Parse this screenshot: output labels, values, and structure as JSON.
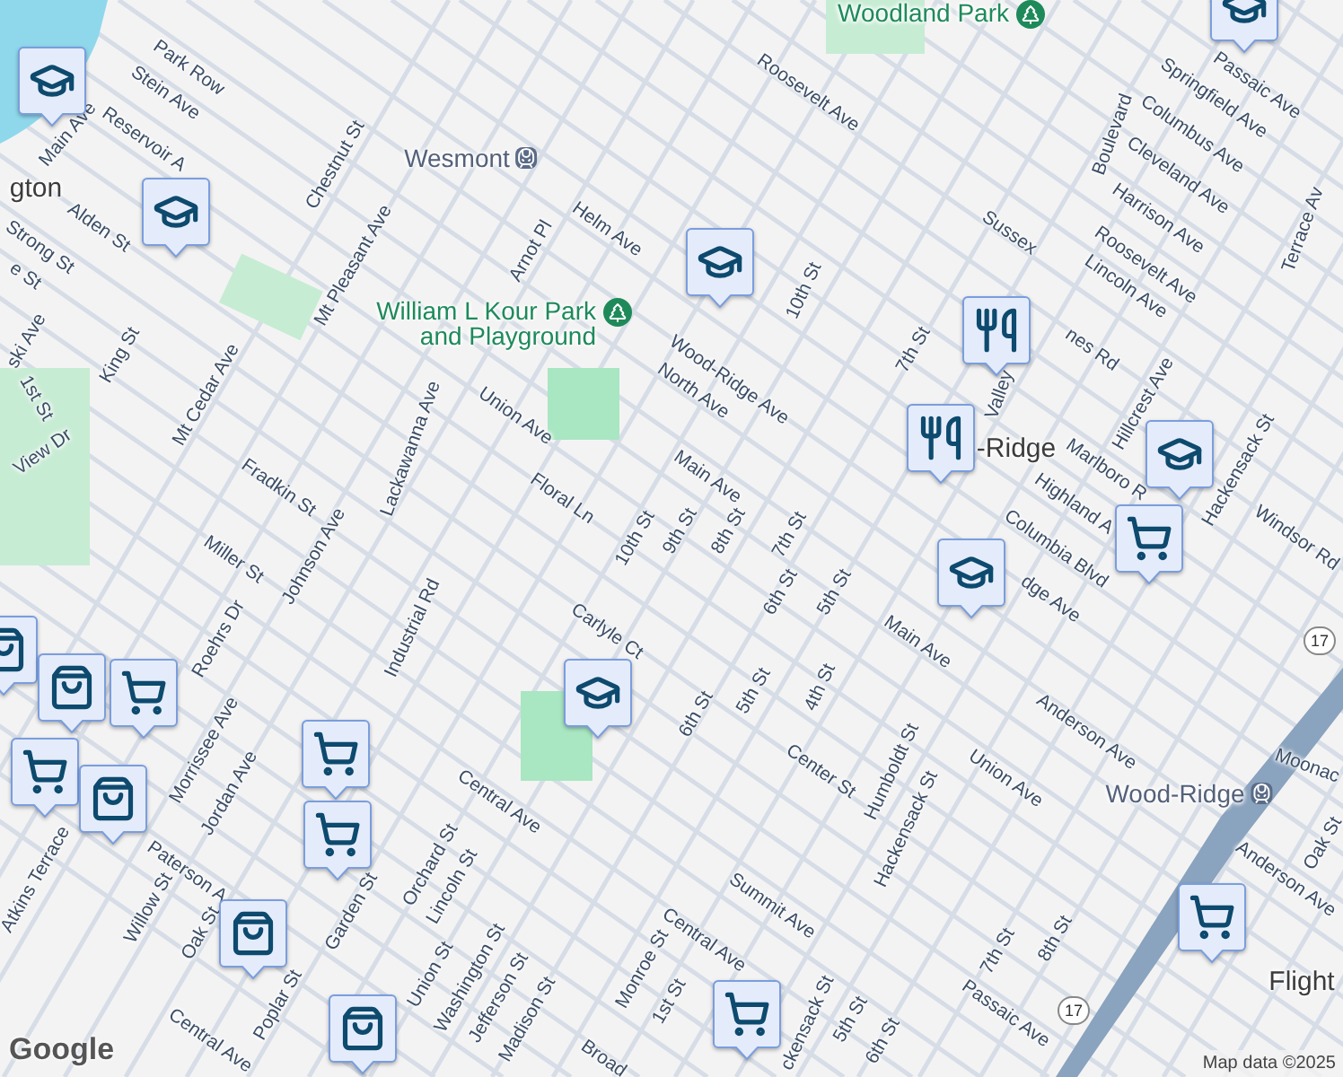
{
  "labels": [
    {
      "text": "Park Row",
      "kind": "street"
    },
    {
      "text": "Stein Ave",
      "kind": "street"
    },
    {
      "text": "Main Ave",
      "kind": "street"
    },
    {
      "text": "Reservoir A",
      "kind": "street"
    },
    {
      "text": "gton",
      "kind": "place"
    },
    {
      "text": "Alden St",
      "kind": "street"
    },
    {
      "text": "Strong St",
      "kind": "street"
    },
    {
      "text": "e St",
      "kind": "street"
    },
    {
      "text": "Chestnut St",
      "kind": "street"
    },
    {
      "text": "Wesmont",
      "kind": "station"
    },
    {
      "text": "Mt Pleasant Ave",
      "kind": "street"
    },
    {
      "text": "Helm Ave",
      "kind": "street"
    },
    {
      "text": "Arnot Pl",
      "kind": "street"
    },
    {
      "text": "William L Kour Park and Playground",
      "kind": "park"
    },
    {
      "text": "ski Ave",
      "kind": "street"
    },
    {
      "text": "King St",
      "kind": "street"
    },
    {
      "text": "1st St",
      "kind": "street"
    },
    {
      "text": "Mt Cedar Ave",
      "kind": "street"
    },
    {
      "text": "Union Ave",
      "kind": "street"
    },
    {
      "text": "Lackawanna Ave",
      "kind": "street"
    },
    {
      "text": "Fradkin St",
      "kind": "street"
    },
    {
      "text": "View Dr",
      "kind": "street"
    },
    {
      "text": "Floral Ln",
      "kind": "street"
    },
    {
      "text": "Woodland Park",
      "kind": "park"
    },
    {
      "text": "Roosevelt Ave",
      "kind": "street"
    },
    {
      "text": "Passaic Ave",
      "kind": "street"
    },
    {
      "text": "Boulevard",
      "kind": "street"
    },
    {
      "text": "Springfield Ave",
      "kind": "street"
    },
    {
      "text": "Columbus Ave",
      "kind": "street"
    },
    {
      "text": "Cleveland Ave",
      "kind": "street"
    },
    {
      "text": "Harrison Ave",
      "kind": "street"
    },
    {
      "text": "Roosevelt Ave",
      "kind": "street"
    },
    {
      "text": "Lincoln Ave",
      "kind": "street"
    },
    {
      "text": "Terrace Av",
      "kind": "street"
    },
    {
      "text": "Sussex",
      "kind": "street"
    },
    {
      "text": "nes Rd",
      "kind": "street"
    },
    {
      "text": "Hillcrest Ave",
      "kind": "street"
    },
    {
      "text": "Marlboro R",
      "kind": "street"
    },
    {
      "text": "Highland A",
      "kind": "street"
    },
    {
      "text": "Hackensack St",
      "kind": "street"
    },
    {
      "text": "Windsor Rd",
      "kind": "street"
    },
    {
      "text": "Wood-Ridge Ave",
      "kind": "street"
    },
    {
      "text": "North Ave",
      "kind": "street"
    },
    {
      "text": "10th St",
      "kind": "street"
    },
    {
      "text": "Main Ave",
      "kind": "street"
    },
    {
      "text": "10th St",
      "kind": "street"
    },
    {
      "text": "9th St",
      "kind": "street"
    },
    {
      "text": "8th St",
      "kind": "street"
    },
    {
      "text": "7th St",
      "kind": "street"
    },
    {
      "text": "7th St",
      "kind": "street"
    },
    {
      "text": "Valley",
      "kind": "street"
    },
    {
      "text": "-Ridge",
      "kind": "place"
    },
    {
      "text": "Columbia Blvd",
      "kind": "street"
    },
    {
      "text": "6th St",
      "kind": "street"
    },
    {
      "text": "5th St",
      "kind": "street"
    },
    {
      "text": "dge Ave",
      "kind": "street"
    },
    {
      "text": "Main Ave",
      "kind": "street"
    },
    {
      "text": "Anderson Ave",
      "kind": "street"
    },
    {
      "text": "Carlyle Ct",
      "kind": "street"
    },
    {
      "text": "6th St",
      "kind": "street"
    },
    {
      "text": "5th St",
      "kind": "street"
    },
    {
      "text": "4th St",
      "kind": "street"
    },
    {
      "text": "Center St",
      "kind": "street"
    },
    {
      "text": "Humboldt St",
      "kind": "street"
    },
    {
      "text": "Hackensack St",
      "kind": "street"
    },
    {
      "text": "Union Ave",
      "kind": "street"
    },
    {
      "text": "Wood-Ridge",
      "kind": "station"
    },
    {
      "text": "Moonac",
      "kind": "street"
    },
    {
      "text": "Oak St",
      "kind": "street"
    },
    {
      "text": "Anderson Ave",
      "kind": "street"
    },
    {
      "text": "Flight",
      "kind": "place"
    },
    {
      "text": "Central Ave",
      "kind": "street"
    },
    {
      "text": "Summit Ave",
      "kind": "street"
    },
    {
      "text": "Central Ave",
      "kind": "street"
    },
    {
      "text": "7th St",
      "kind": "street"
    },
    {
      "text": "8th St",
      "kind": "street"
    },
    {
      "text": "Passaic Ave",
      "kind": "street"
    },
    {
      "text": "5th St",
      "kind": "street"
    },
    {
      "text": "6th St",
      "kind": "street"
    },
    {
      "text": "Monroe St",
      "kind": "street"
    },
    {
      "text": "1st St",
      "kind": "street"
    },
    {
      "text": "Broad",
      "kind": "street"
    },
    {
      "text": "ckensack St",
      "kind": "street"
    },
    {
      "text": "Miller St",
      "kind": "street"
    },
    {
      "text": "Johnson Ave",
      "kind": "street"
    },
    {
      "text": "Industrial Rd",
      "kind": "street"
    },
    {
      "text": "Roehrs Dr",
      "kind": "street"
    },
    {
      "text": "Morrissee Ave",
      "kind": "street"
    },
    {
      "text": "Jordan Ave",
      "kind": "street"
    },
    {
      "text": "Atkins Terrace",
      "kind": "street"
    },
    {
      "text": "Willow St",
      "kind": "street"
    },
    {
      "text": "Paterson A",
      "kind": "street"
    },
    {
      "text": "Oak St",
      "kind": "street"
    },
    {
      "text": "Garden St",
      "kind": "street"
    },
    {
      "text": "Orchard St",
      "kind": "street"
    },
    {
      "text": "Lincoln St",
      "kind": "street"
    },
    {
      "text": "Union St",
      "kind": "street"
    },
    {
      "text": "Washington St",
      "kind": "street"
    },
    {
      "text": "Jefferson St",
      "kind": "street"
    },
    {
      "text": "Madison St",
      "kind": "street"
    },
    {
      "text": "Poplar St",
      "kind": "street"
    },
    {
      "text": "Central Ave",
      "kind": "street"
    },
    {
      "text": "17",
      "kind": "route"
    },
    {
      "text": "17",
      "kind": "route"
    }
  ],
  "markers": [
    {
      "kind": "school"
    },
    {
      "kind": "school"
    },
    {
      "kind": "school"
    },
    {
      "kind": "school"
    },
    {
      "kind": "school"
    },
    {
      "kind": "school"
    },
    {
      "kind": "school"
    },
    {
      "kind": "food"
    },
    {
      "kind": "food"
    },
    {
      "kind": "cart"
    },
    {
      "kind": "cart"
    },
    {
      "kind": "cart"
    },
    {
      "kind": "cart"
    },
    {
      "kind": "cart"
    },
    {
      "kind": "cart"
    },
    {
      "kind": "cart"
    },
    {
      "kind": "bag"
    },
    {
      "kind": "bag"
    },
    {
      "kind": "bag"
    },
    {
      "kind": "bag"
    },
    {
      "kind": "bag"
    }
  ],
  "attribution": {
    "logo": "Google",
    "text": "Map data ©2025"
  }
}
